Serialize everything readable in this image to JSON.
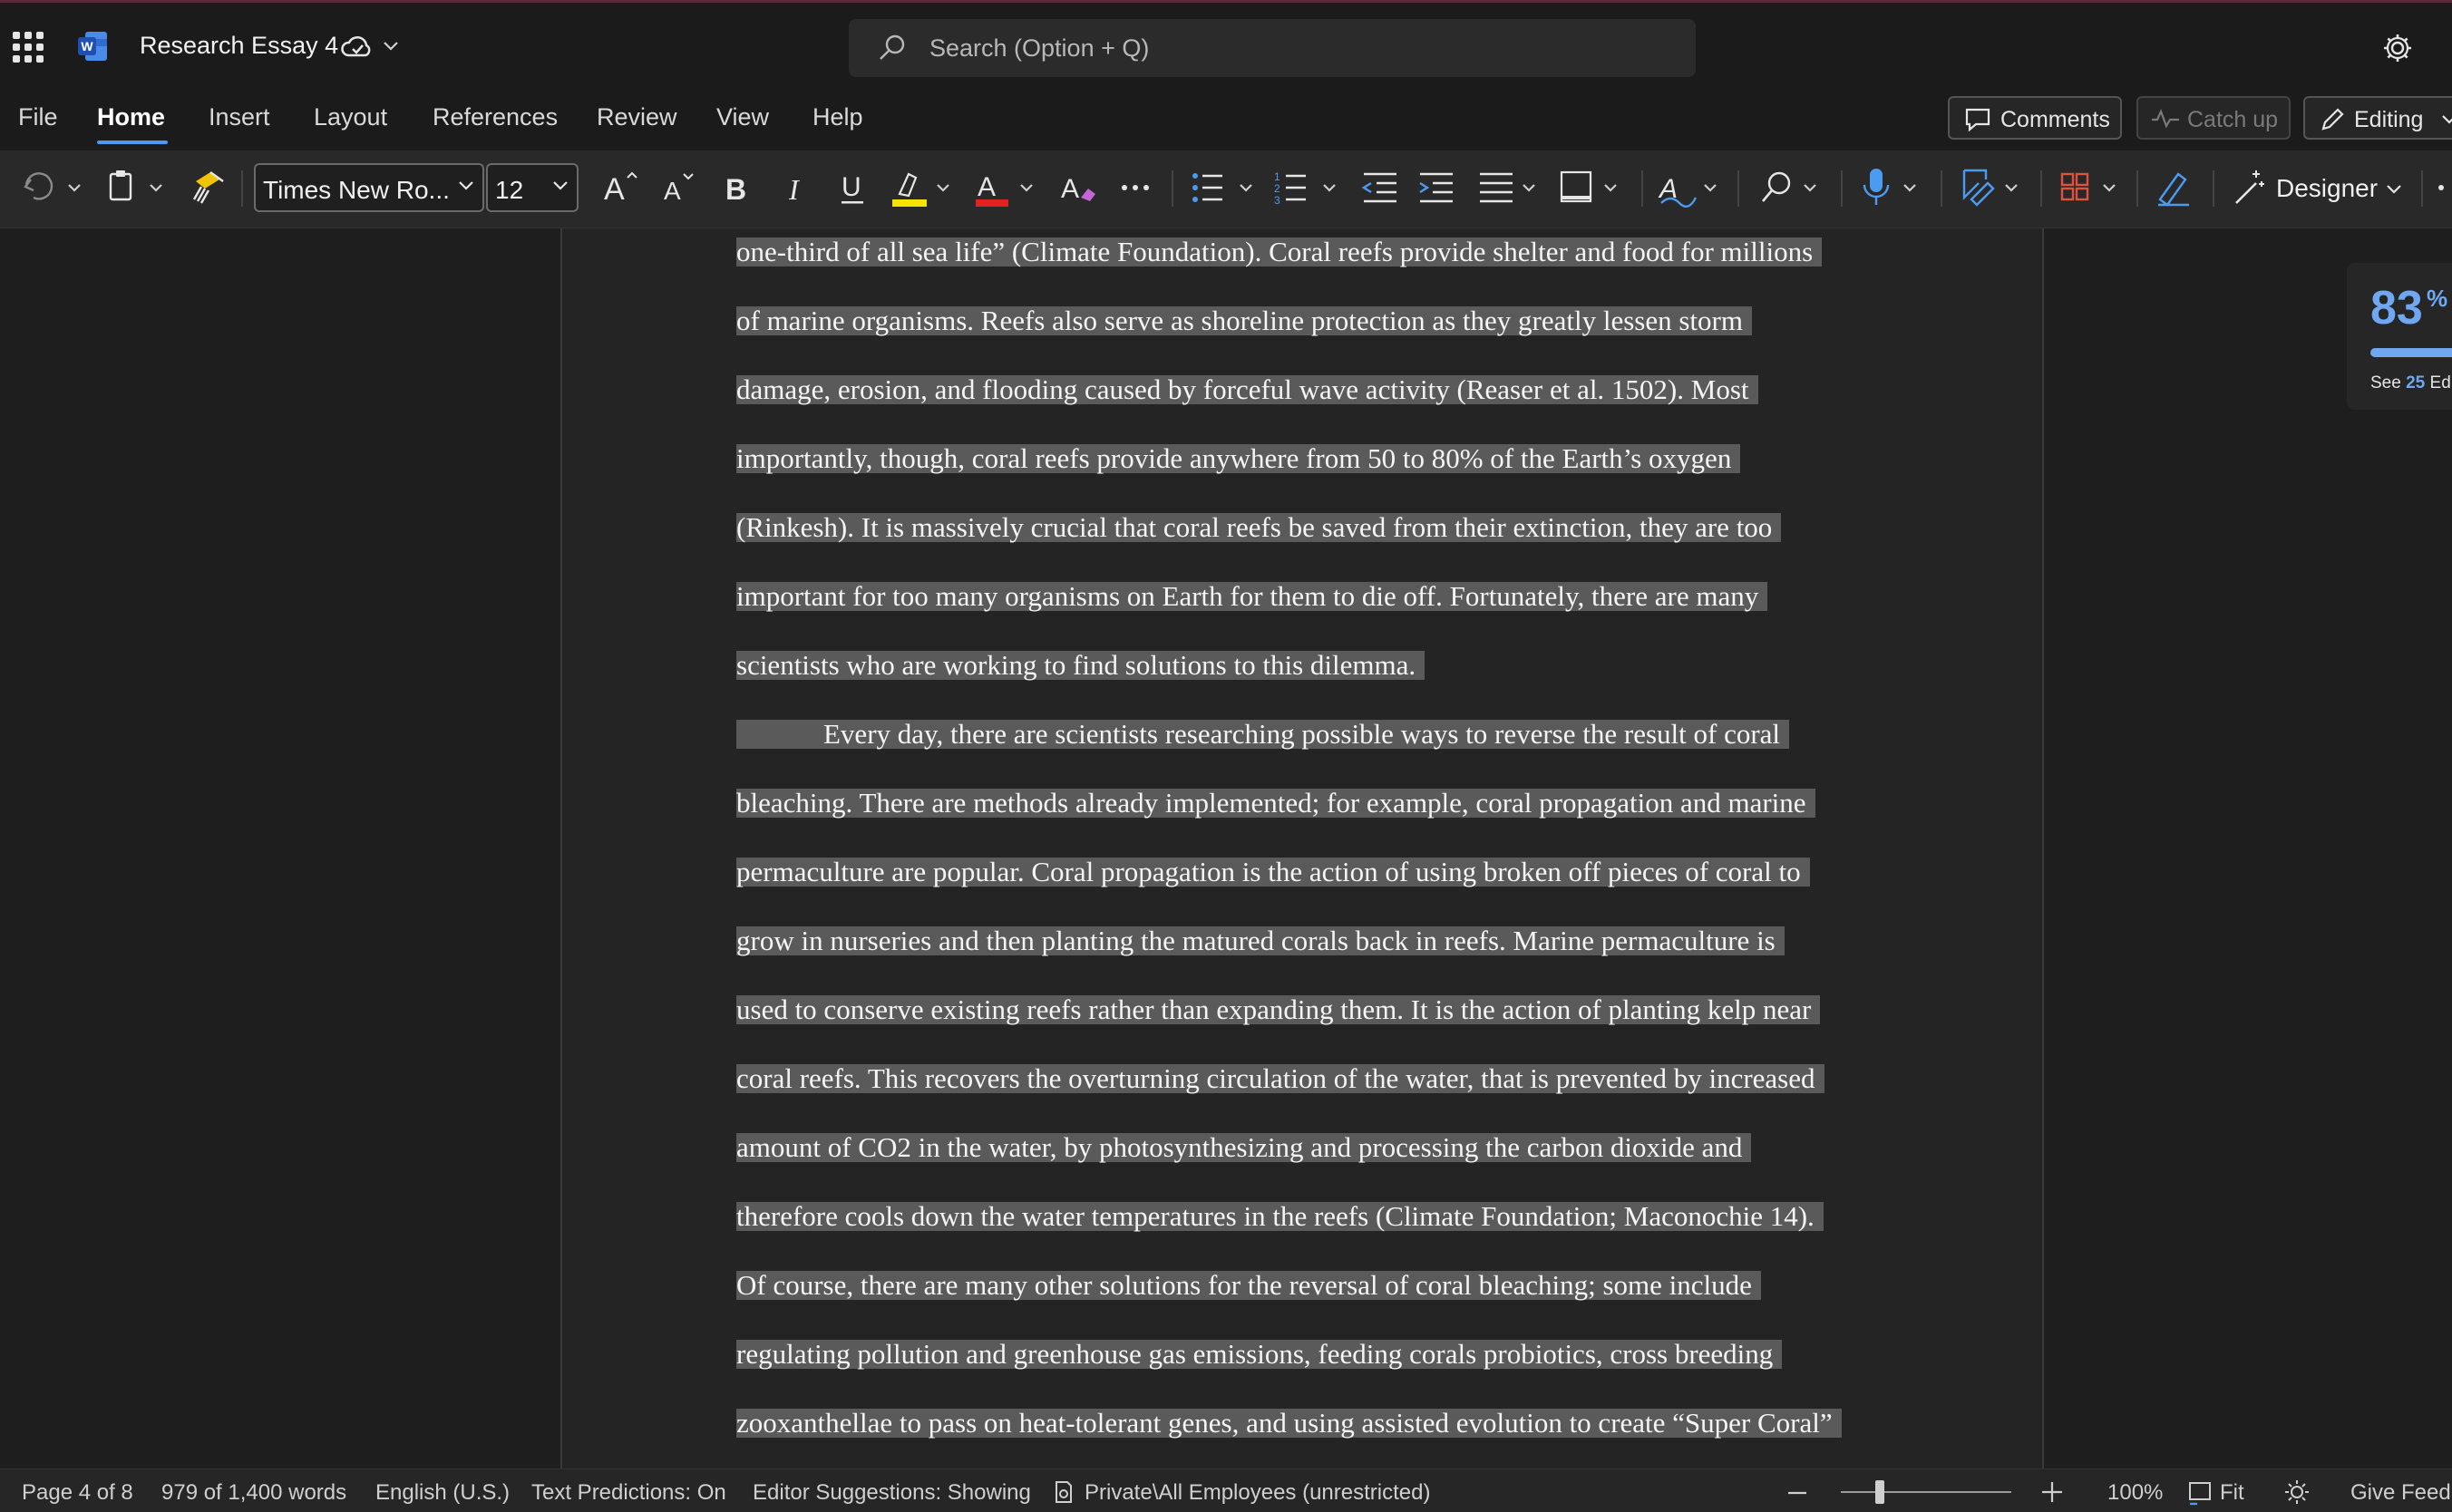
{
  "app": {
    "doc_title": "Research Essay 4",
    "search_placeholder": "Search (Option + Q)"
  },
  "menu": {
    "items": [
      "File",
      "Home",
      "Insert",
      "Layout",
      "References",
      "Review",
      "View",
      "Help"
    ],
    "active": "Home",
    "comments_label": "Comments",
    "catchup_label": "Catch up",
    "editing_label": "Editing"
  },
  "ribbon": {
    "font_name": "Times New Ro...",
    "font_size": "12",
    "designer_label": "Designer",
    "highlight_color": "#f5e400",
    "font_color": "#e0231f"
  },
  "document": {
    "lines": [
      "one-third of all sea life” (Climate Foundation). Coral reefs provide shelter and food for millions",
      "of marine organisms. Reefs also serve as shoreline protection as they greatly lessen storm",
      "damage, erosion, and flooding caused by forceful wave activity (Reaser et al. 1502). Most",
      "importantly, though, coral reefs provide anywhere from 50 to 80% of the Earth’s oxygen",
      "(Rinkesh). It is massively crucial that coral reefs be saved from their extinction, they are too",
      "important for too many organisms on Earth for them to die off. Fortunately, there are many",
      "scientists who are working to find solutions to this dilemma.",
      "Every day, there are scientists researching possible ways to reverse the result of coral",
      "bleaching. There are methods already implemented; for example, coral propagation and marine",
      "permaculture are popular. Coral propagation is the action of using broken off pieces of coral to",
      "grow in nurseries and then planting the matured corals back in reefs. Marine permaculture is",
      "used to conserve existing reefs rather than expanding them. It is the action of planting kelp near",
      "coral reefs. This recovers the overturning circulation of the water, that is prevented by increased",
      "amount of CO2 in the water, by photosynthesizing and processing the carbon dioxide and",
      "therefore cools down the water temperatures in the reefs (Climate Foundation; Maconochie 14).",
      "Of course, there are many other solutions for the reversal of coral bleaching; some include",
      "regulating pollution and greenhouse gas emissions, feeding corals probiotics, cross breeding",
      "zooxanthellae to pass on heat-tolerant genes, and using assisted evolution to create “Super Coral”"
    ]
  },
  "editor_score": {
    "score": "83",
    "percent_sign": "%",
    "see_prefix": "See",
    "see_count": "25",
    "see_suffix": "Edi",
    "progress": 0.83
  },
  "status": {
    "page": "Page 4 of 8",
    "words": "979 of 1,400 words",
    "language": "English (U.S.)",
    "predictions": "Text Predictions: On",
    "editor": "Editor Suggestions: Showing",
    "sensitivity": "Private\\All Employees (unrestricted)",
    "zoom": "100%",
    "fit": "Fit",
    "feedback": "Give Feedb",
    "zoom_level": 1.0
  }
}
